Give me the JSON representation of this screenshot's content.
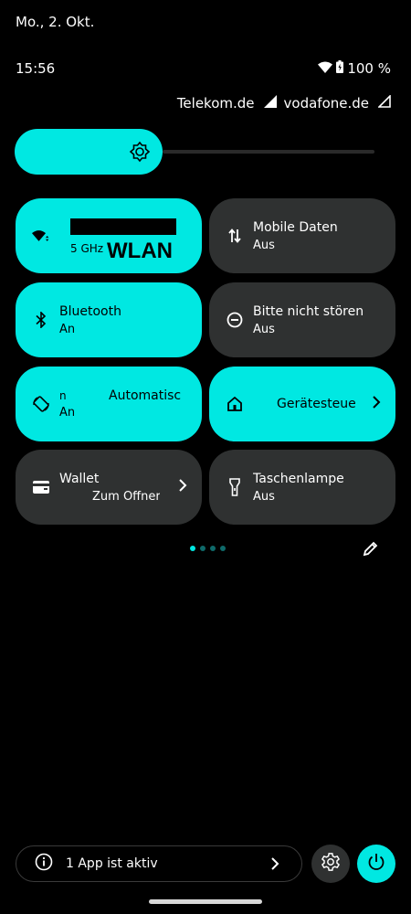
{
  "status": {
    "date": "Mo., 2. Okt.",
    "time": "15:56",
    "battery_text": "100 %",
    "carriers": [
      "Telekom.de",
      "vodafone.de"
    ]
  },
  "brightness": {
    "level": 0.41
  },
  "tiles": [
    {
      "id": "wlan",
      "title": "",
      "subtitle": "5 GHz",
      "overlay_label": "WLAN",
      "active": true,
      "chevron": false
    },
    {
      "id": "mobile-data",
      "title": "Mobile Daten",
      "subtitle": "Aus",
      "active": false,
      "chevron": false
    },
    {
      "id": "bluetooth",
      "title": "Bluetooth",
      "subtitle": "An",
      "active": true,
      "chevron": false
    },
    {
      "id": "dnd",
      "title": "Bitte nicht stören",
      "subtitle": "Aus",
      "active": false,
      "chevron": false
    },
    {
      "id": "autorotate",
      "title": "n",
      "title_right": "Automatisc",
      "subtitle": "An",
      "active": true,
      "chevron": false
    },
    {
      "id": "device-control",
      "title": "Gerätesteuer",
      "subtitle": "",
      "active": true,
      "chevron": true
    },
    {
      "id": "wallet",
      "title": "Wallet",
      "subtitle": "Zum Öffner",
      "active": false,
      "chevron": true
    },
    {
      "id": "flashlight",
      "title": "Taschenlampe",
      "subtitle": "Aus",
      "active": false,
      "chevron": false
    }
  ],
  "pager": {
    "count": 4,
    "current": 0
  },
  "footer": {
    "active_apps": "1 App ist aktiv"
  },
  "colors": {
    "accent": "#00e8e2",
    "tile_off": "#2f3131",
    "background": "#000000"
  }
}
